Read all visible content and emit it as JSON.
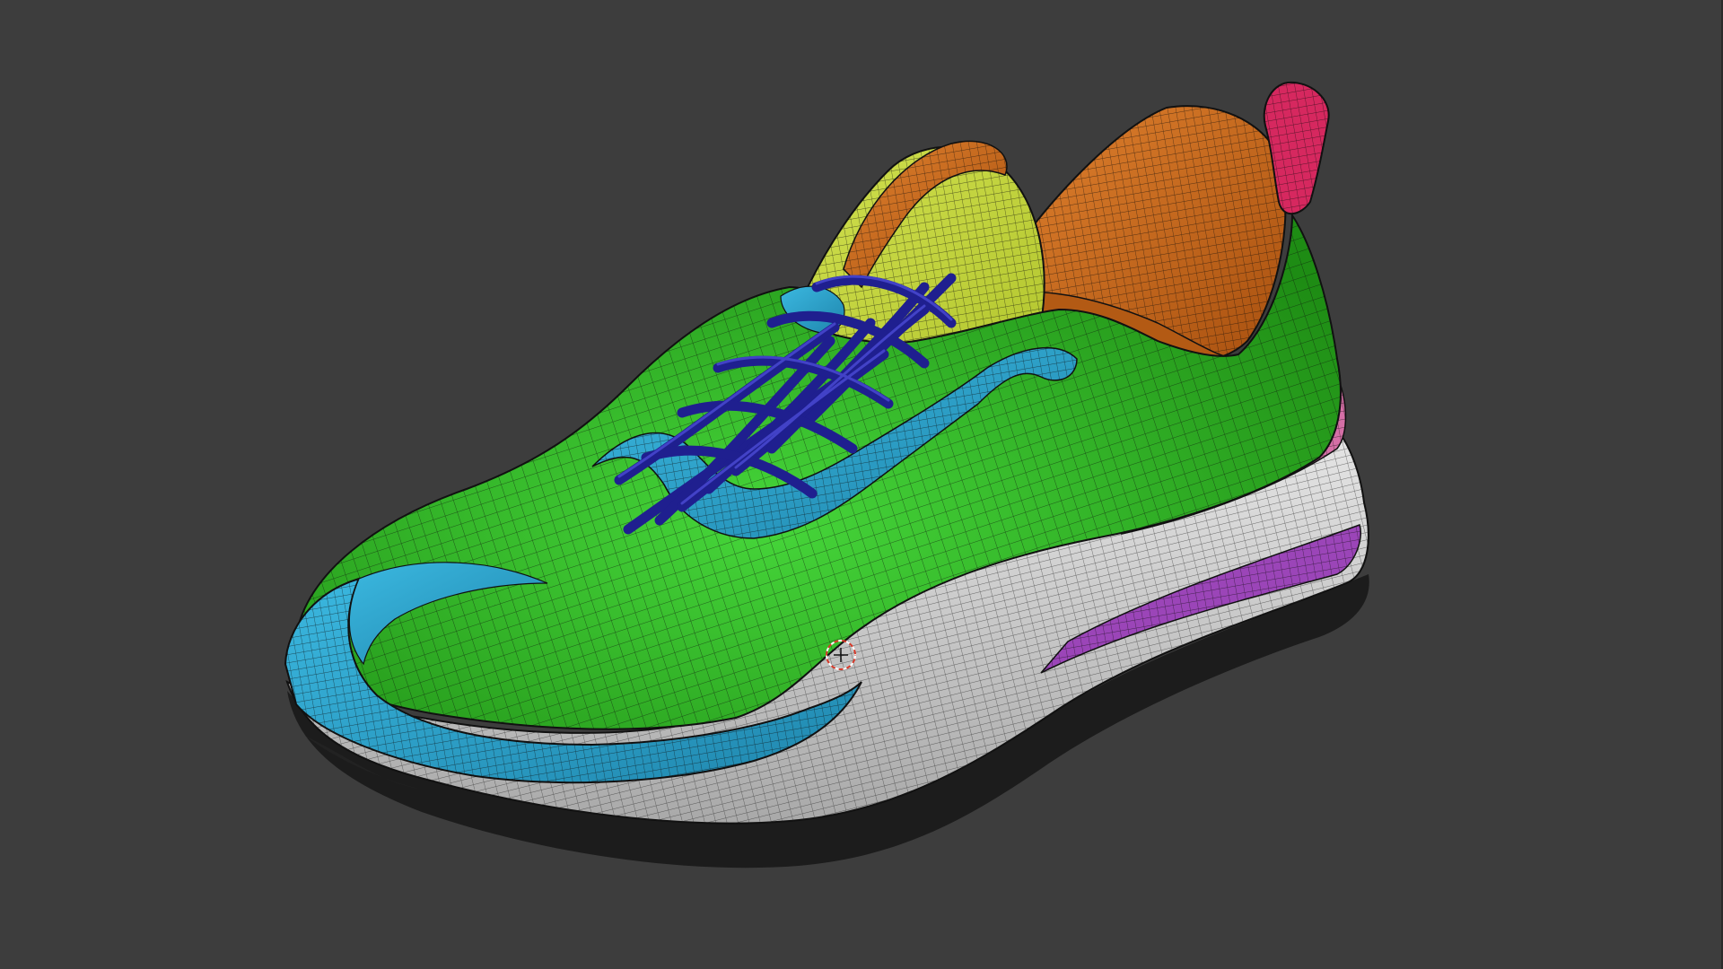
{
  "viewport": {
    "background": "#3d3d3d",
    "shading": "solid-wireframe-overlay",
    "cursor_icon": "3d-cursor-icon"
  },
  "model": {
    "subject": "running shoe",
    "parts": [
      {
        "name": "sole-midsole",
        "color": "#cfcfcf"
      },
      {
        "name": "sole-outsole",
        "color": "#1f1f1f"
      },
      {
        "name": "heel-accent-pink",
        "color": "#d56fa6"
      },
      {
        "name": "heel-accent-purple",
        "color": "#9b45b8"
      },
      {
        "name": "upper-main",
        "color": "#2fb81f"
      },
      {
        "name": "toe-cap-overlay",
        "color": "#2fa6cf"
      },
      {
        "name": "eyestay-overlay",
        "color": "#2fa6cf"
      },
      {
        "name": "tongue",
        "color": "#c8db3a"
      },
      {
        "name": "collar-lining",
        "color": "#cf6a1f"
      },
      {
        "name": "tongue-edge",
        "color": "#cf6a1f"
      },
      {
        "name": "heel-pull-tab",
        "color": "#d6285f"
      },
      {
        "name": "laces",
        "color": "#2a2aa8"
      }
    ]
  }
}
